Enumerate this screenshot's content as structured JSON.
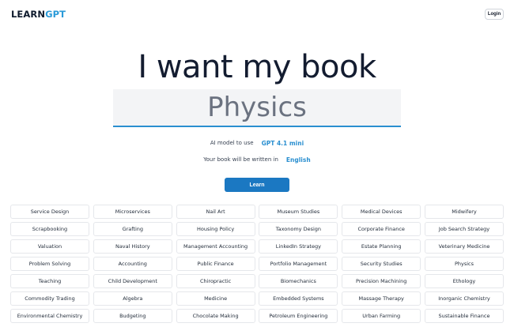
{
  "header": {
    "logo_learn": "LEARN",
    "logo_gpt": "GPT",
    "login_label": "Login"
  },
  "hero": {
    "headline": "I want my book",
    "topic_value": "Physics",
    "model_label": "AI model to use",
    "model_value": "GPT 4.1 mini",
    "language_label": "Your book will be written in",
    "language_value": "English",
    "learn_label": "Learn"
  },
  "topics": [
    "Service Design",
    "Microservices",
    "Nail Art",
    "Museum Studies",
    "Medical Devices",
    "Midwifery",
    "Scrapbooking",
    "Grafting",
    "Housing Policy",
    "Taxonomy Design",
    "Corporate Finance",
    "Job Search Strategy",
    "Valuation",
    "Naval History",
    "Management Accounting",
    "LinkedIn Strategy",
    "Estate Planning",
    "Veterinary Medicine",
    "Problem Solving",
    "Accounting",
    "Public Finance",
    "Portfolio Management",
    "Security Studies",
    "Physics",
    "Teaching",
    "Child Development",
    "Chiropractic",
    "Biomechanics",
    "Precision Machining",
    "Ethology",
    "Commodity Trading",
    "Algebra",
    "Medicine",
    "Embedded Systems",
    "Massage Therapy",
    "Inorganic Chemistry",
    "Environmental Chemistry",
    "Budgeting",
    "Chocolate Making",
    "Petroleum Engineering",
    "Urban Farming",
    "Sustainable Finance"
  ],
  "colors": {
    "accent": "#2a8fd0",
    "button": "#1b78c2",
    "headline": "#131c30"
  }
}
